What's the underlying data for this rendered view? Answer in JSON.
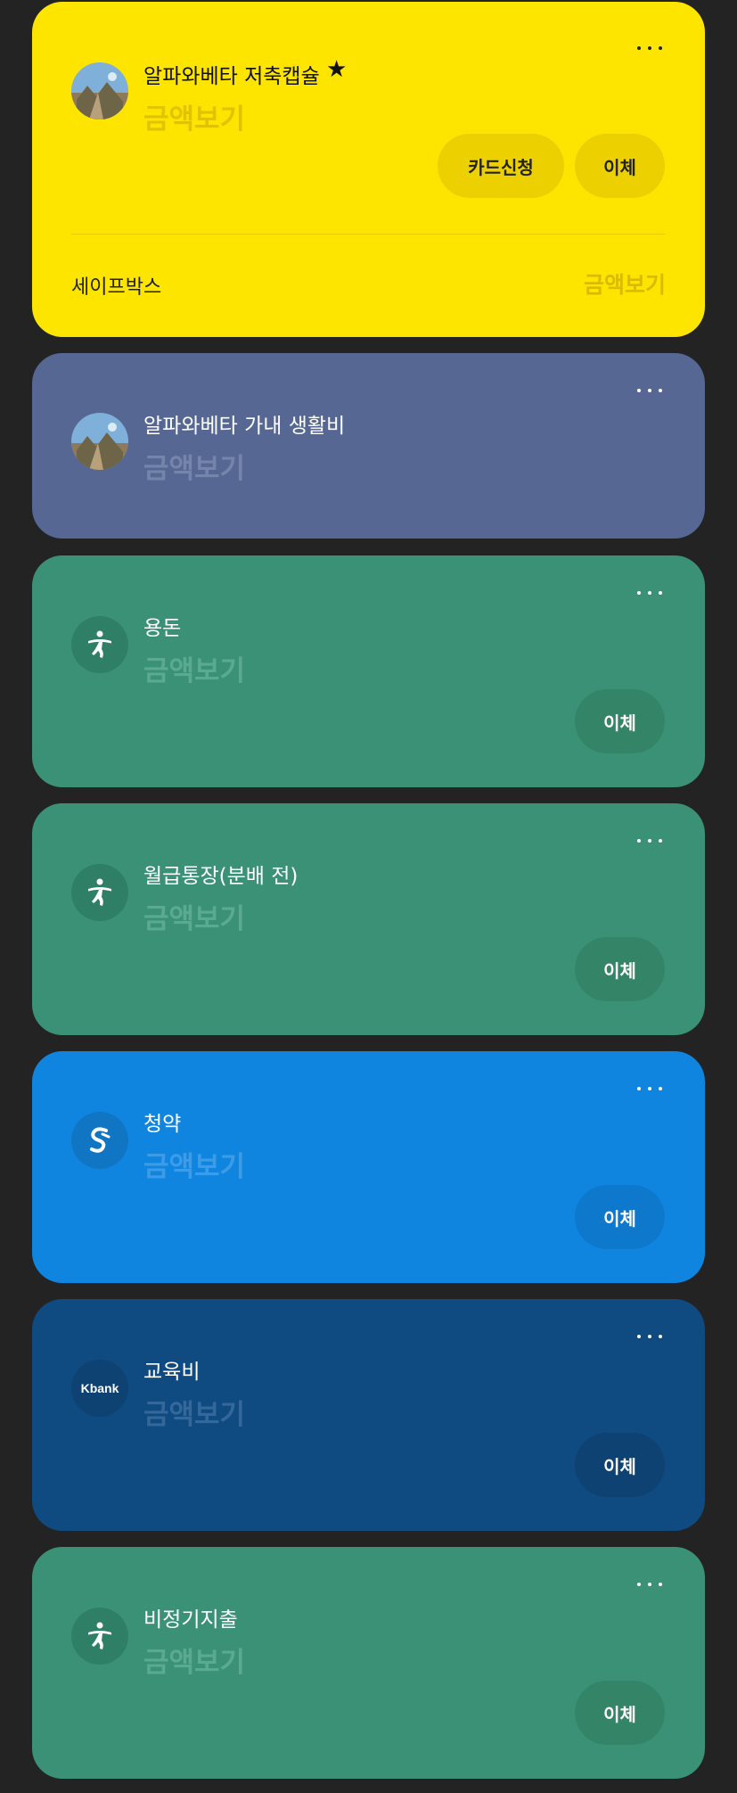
{
  "accounts": [
    {
      "name": "알파와베타 저축캡슐",
      "star": "★",
      "amount_label": "금액보기",
      "buttons": [
        "카드신청",
        "이체"
      ],
      "sub": {
        "label": "세이프박스",
        "amount_label": "금액보기"
      },
      "icon": "landscape-photo-avatar",
      "color": "#FEE500"
    },
    {
      "name": "알파와베타 가내 생활비",
      "amount_label": "금액보기",
      "icon": "landscape-photo-avatar",
      "color": "#566793"
    },
    {
      "name": "용돈",
      "amount_label": "금액보기",
      "transfer_label": "이체",
      "icon": "hana-bank-logo",
      "color": "#3A9175"
    },
    {
      "name": "월급통장(분배 전)",
      "amount_label": "금액보기",
      "transfer_label": "이체",
      "icon": "hana-bank-logo",
      "color": "#3A9175"
    },
    {
      "name": "청약",
      "amount_label": "금액보기",
      "transfer_label": "이체",
      "icon": "shinhan-bank-logo",
      "color": "#0F85E0"
    },
    {
      "name": "교육비",
      "amount_label": "금액보기",
      "transfer_label": "이체",
      "icon": "kbank-logo",
      "icon_text": "Kbank",
      "color": "#0F4A80"
    },
    {
      "name": "비정기지출",
      "amount_label": "금액보기",
      "transfer_label": "이체",
      "icon": "hana-bank-logo",
      "color": "#3A9175"
    }
  ]
}
